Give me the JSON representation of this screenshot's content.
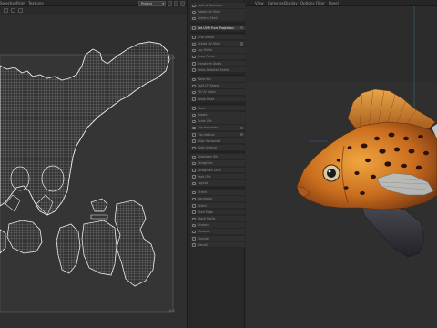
{
  "uv_editor": {
    "menu": [
      "Selection",
      "Paint",
      "Textures"
    ],
    "project_dropdown": "Project",
    "project_chevron": "▾",
    "corner_labels": {
      "top_right": "1.0",
      "bottom_right": "0.0"
    }
  },
  "tool_panel": {
    "items": [
      {
        "label": "Look at Selection",
        "active": false,
        "check": false
      },
      {
        "label": "Rotate UV Shell",
        "active": false,
        "check": false
      },
      {
        "label": "Uniform Shell",
        "active": false,
        "check": false
      },
      {
        "label": "Set UVW From Projection",
        "active": true,
        "check": true
      },
      {
        "label": "Grid Unfold",
        "active": false,
        "check": false
      },
      {
        "label": "Unfold UV Shell",
        "active": false,
        "check": true
      },
      {
        "label": "Lay Shells",
        "active": false,
        "check": false
      },
      {
        "label": "Snap Points",
        "active": false,
        "check": false
      },
      {
        "label": "Transform Shells",
        "active": false,
        "check": false
      },
      {
        "label": "Relax Selected Shells",
        "active": false,
        "check": false
      },
      {
        "label": "Weld UVs",
        "active": false,
        "check": false
      },
      {
        "label": "Split UV Seams",
        "active": false,
        "check": false
      },
      {
        "label": "Fill UV Holes",
        "active": false,
        "check": false
      },
      {
        "label": "Seam Lines",
        "active": false,
        "check": false
      },
      {
        "label": "Move",
        "active": false,
        "check": false
      },
      {
        "label": "Rotate",
        "active": false,
        "check": false
      },
      {
        "label": "Scale UVs",
        "active": false,
        "check": false
      },
      {
        "label": "Flip Horizontal",
        "active": false,
        "check": true
      },
      {
        "label": "Flip Vertical",
        "active": false,
        "check": true
      },
      {
        "label": "Align Horizontal",
        "active": false,
        "check": false
      },
      {
        "label": "Align Vertical",
        "active": false,
        "check": false
      },
      {
        "label": "Distribute UVs",
        "active": false,
        "check": false
      },
      {
        "label": "Straighten",
        "active": false,
        "check": false
      },
      {
        "label": "Straighten Shell",
        "active": false,
        "check": false
      },
      {
        "label": "Pack UVs",
        "active": false,
        "check": false
      },
      {
        "label": "Layout",
        "active": false,
        "check": false
      },
      {
        "label": "Orient",
        "active": false,
        "check": false
      },
      {
        "label": "Normalize",
        "active": false,
        "check": false
      },
      {
        "label": "Select",
        "active": false,
        "check": false
      },
      {
        "label": "Shell Edge",
        "active": false,
        "check": false
      },
      {
        "label": "Stack Shells",
        "active": false,
        "check": false
      },
      {
        "label": "Unstack",
        "active": false,
        "check": false
      },
      {
        "label": "Measure",
        "active": false,
        "check": false
      },
      {
        "label": "Checker",
        "active": false,
        "check": false
      },
      {
        "label": "Density",
        "active": false,
        "check": false
      }
    ]
  },
  "viewport": {
    "menu": [
      "View",
      "Cameras",
      "Display",
      "Options",
      "Filter",
      "Panel"
    ]
  },
  "colors": {
    "uv_wire": "#e6e6e6",
    "fish_orange": "#d98a2a",
    "fish_dark": "#2a1a10",
    "fin_dark": "#3a3a40",
    "accent_line": "#3fa3b5"
  }
}
